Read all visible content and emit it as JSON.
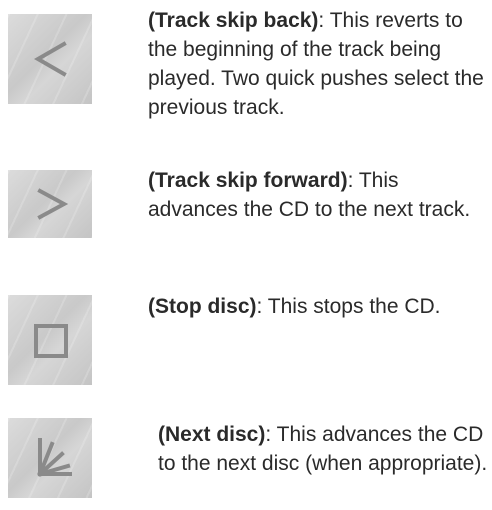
{
  "entries": [
    {
      "icon": "chevron-left-icon",
      "name": "(Track skip back)",
      "text": ": This reverts to the beginning of the track being played. Two quick pushes select the previous track."
    },
    {
      "icon": "chevron-right-icon",
      "name": "(Track skip forward)",
      "text": ": This advances the CD to the next track."
    },
    {
      "icon": "stop-square-icon",
      "name": "(Stop disc)",
      "text": ": This stops the CD."
    },
    {
      "icon": "next-disc-icon",
      "name": "(Next disc)",
      "text": ": This advances the CD to the next disc (when appropriate)."
    }
  ],
  "colors": {
    "icon_stroke": "#8a8a8a",
    "text": "#2a2a2a"
  }
}
